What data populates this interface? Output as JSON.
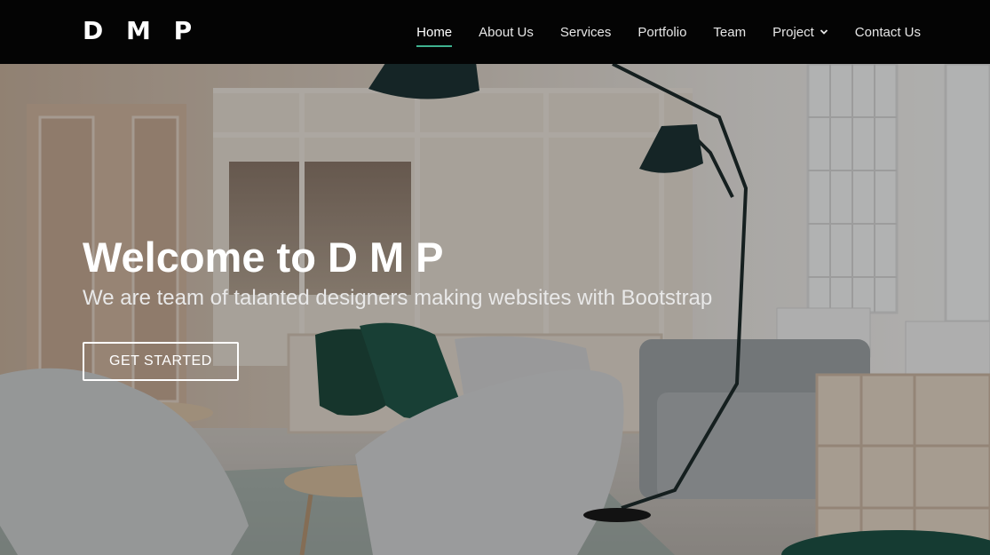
{
  "brand": {
    "logo": "D M P"
  },
  "nav": {
    "items": [
      {
        "label": "Home"
      },
      {
        "label": "About Us"
      },
      {
        "label": "Services"
      },
      {
        "label": "Portfolio"
      },
      {
        "label": "Team"
      },
      {
        "label": "Project"
      },
      {
        "label": "Contact Us"
      }
    ],
    "active": "Home",
    "dropdown_icon": "chevron-down-icon",
    "accent_color": "#3fb28f"
  },
  "hero": {
    "title": "Welcome to D M P",
    "subtitle": "We are team of talanted designers making websites with Bootstrap",
    "cta_label": "GET STARTED"
  }
}
